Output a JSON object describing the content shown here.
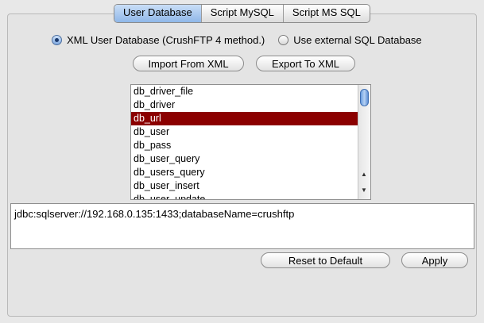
{
  "tabs": [
    {
      "label": "User Database",
      "active": true
    },
    {
      "label": "Script MySQL",
      "active": false
    },
    {
      "label": "Script MS SQL",
      "active": false
    }
  ],
  "radio": {
    "xml_label": "XML User Database (CrushFTP 4 method.)",
    "xml_selected": true,
    "sql_label": "Use external SQL Database",
    "sql_selected": false
  },
  "buttons": {
    "import": "Import From XML",
    "export": "Export To XML",
    "reset": "Reset to Default",
    "apply": "Apply"
  },
  "list": {
    "items": [
      "db_driver_file",
      "db_driver",
      "db_url",
      "db_user",
      "db_pass",
      "db_user_query",
      "db_users_query",
      "db_user_insert",
      "db_user_update"
    ],
    "selected_index": 2,
    "selection_color": "#8b0000"
  },
  "value_field": {
    "text": "jdbc:sqlserver://192.168.0.135:1433;databaseName=crushftp"
  }
}
